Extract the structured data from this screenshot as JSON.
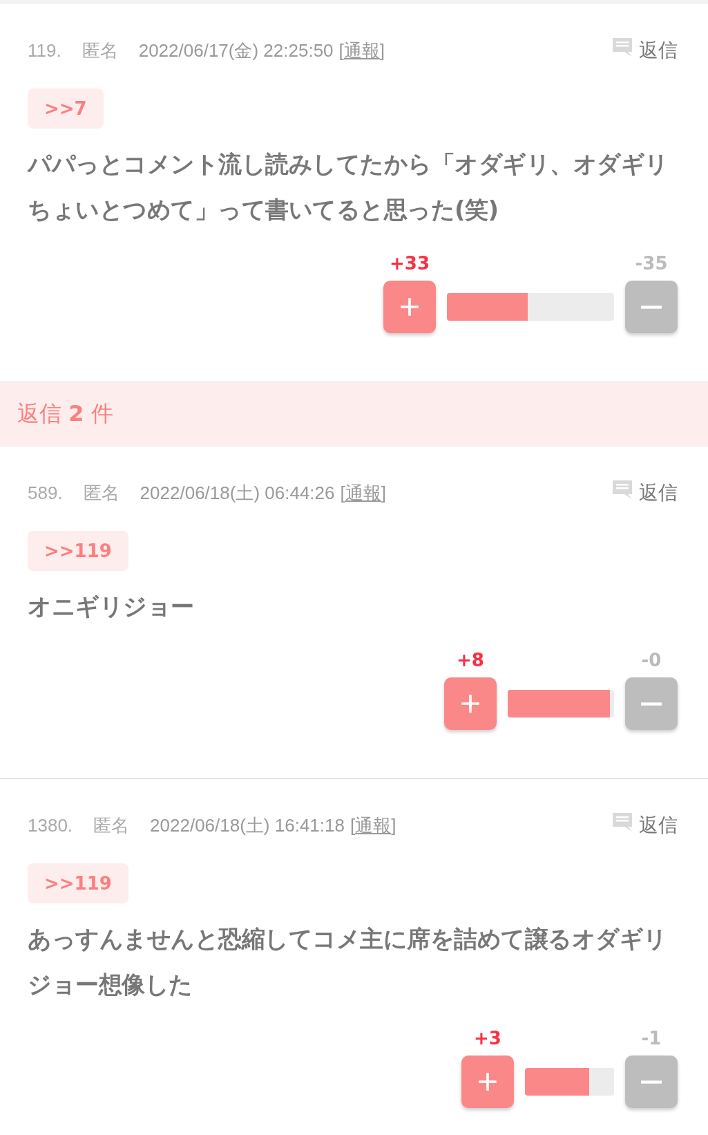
{
  "comments": [
    {
      "number": "119.",
      "author": "匿名",
      "datetime": "2022/06/17(金) 22:25:50",
      "report_open": "[",
      "report": "通報",
      "report_close": "]",
      "reply_label": "返信",
      "anchor": ">>7",
      "body": "パパっとコメント流し読みしてたから「オダギリ、オダギリちょいとつめて」って書いてると思った(笑)",
      "plus": "+33",
      "minus": "-35",
      "level": 0.485
    },
    {
      "kind": "banner",
      "text": "返信 **2** 件"
    },
    {
      "number": "589.",
      "author": "匿名",
      "datetime": "2022/06/18(土) 06:44:26",
      "report_open": "[",
      "report": "通報",
      "report_close": "]",
      "reply_label": "返信",
      "anchor": ">>119",
      "body": "オニギリジョー",
      "plus": "+8",
      "minus": "-0",
      "level": 0.96
    },
    {
      "number": "1380.",
      "author": "匿名",
      "datetime": "2022/06/18(土) 16:41:18",
      "report_open": "[",
      "report": "通報",
      "report_close": "]",
      "reply_label": "返信",
      "anchor": ">>119",
      "body": "あっすんませんと恐縮してコメ主に席を詰めて譲るオダギリジョー想像した",
      "plus": "+3",
      "minus": "-1",
      "level": 0.72
    }
  ]
}
